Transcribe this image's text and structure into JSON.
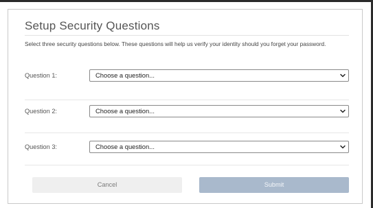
{
  "dialog": {
    "title": "Setup Security Questions",
    "description": "Select three security questions below. These questions will help us verify your identity should you forget your password."
  },
  "questions": [
    {
      "label": "Question 1:",
      "selected": "Choose a question..."
    },
    {
      "label": "Question 2:",
      "selected": "Choose a question..."
    },
    {
      "label": "Question 3:",
      "selected": "Choose a question..."
    }
  ],
  "buttons": {
    "cancel_label": "Cancel",
    "submit_label": "Submit"
  },
  "colors": {
    "submit_bg": "#a9b9cc",
    "cancel_bg": "#efefef",
    "border": "#c9c9c9"
  },
  "icons": {
    "select_arrow": "chevron-down-icon"
  }
}
